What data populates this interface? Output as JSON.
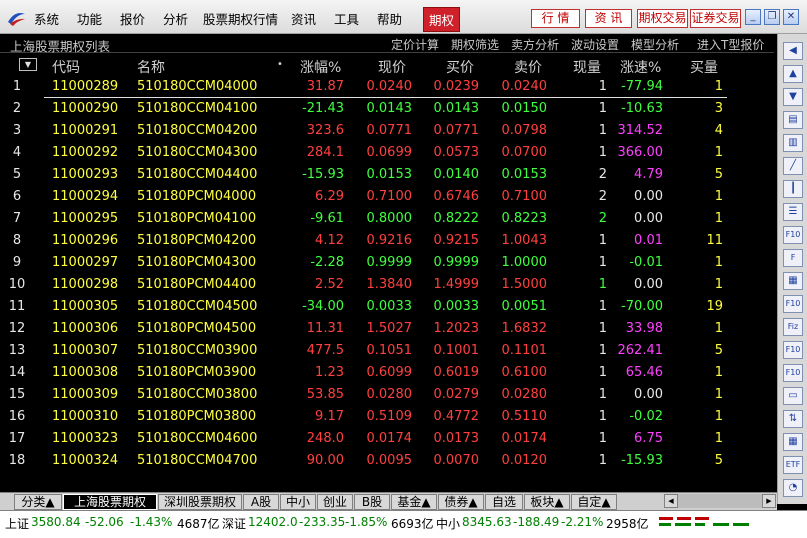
{
  "menu": {
    "items": [
      "系统",
      "功能",
      "报价",
      "分析",
      "股票期权行情",
      "资讯",
      "工具",
      "帮助"
    ],
    "active_item": "期权",
    "tools": [
      "行 情",
      "资 讯",
      "期权交易",
      "证券交易"
    ],
    "window_controls": [
      "minimize-icon",
      "restore-icon",
      "close-icon"
    ]
  },
  "titlebar": {
    "title": "上海股票期权列表",
    "links": [
      "定价计算",
      "期权筛选",
      "卖方分析",
      "波动设置",
      "模型分析",
      "进入T型报价"
    ]
  },
  "table": {
    "columns": [
      "代码",
      "名称",
      "•",
      "涨幅%",
      "现价",
      "买价",
      "卖价",
      "现量",
      "涨速%",
      "买量"
    ],
    "rows": [
      {
        "idx": "1",
        "code": "11000289",
        "name": "510180CCM04000",
        "chg": "31.87",
        "price": "0.0240",
        "bid": "0.0239",
        "ask": "0.0240",
        "vol": "1",
        "spd": "-77.94",
        "bq": "1"
      },
      {
        "idx": "2",
        "code": "11000290",
        "name": "510180CCM04100",
        "chg": "-21.43",
        "price": "0.0143",
        "bid": "0.0143",
        "ask": "0.0150",
        "vol": "1",
        "spd": "-10.63",
        "bq": "3"
      },
      {
        "idx": "3",
        "code": "11000291",
        "name": "510180CCM04200",
        "chg": "323.6",
        "price": "0.0771",
        "bid": "0.0771",
        "ask": "0.0798",
        "vol": "1",
        "spd": "314.52",
        "bq": "4"
      },
      {
        "idx": "4",
        "code": "11000292",
        "name": "510180CCM04300",
        "chg": "284.1",
        "price": "0.0699",
        "bid": "0.0573",
        "ask": "0.0700",
        "vol": "1",
        "spd": "366.00",
        "bq": "1"
      },
      {
        "idx": "5",
        "code": "11000293",
        "name": "510180CCM04400",
        "chg": "-15.93",
        "price": "0.0153",
        "bid": "0.0140",
        "ask": "0.0153",
        "vol": "2",
        "spd": "4.79",
        "bq": "5"
      },
      {
        "idx": "6",
        "code": "11000294",
        "name": "510180PCM04000",
        "chg": "6.29",
        "price": "0.7100",
        "bid": "0.6746",
        "ask": "0.7100",
        "vol": "2",
        "spd": "0.00",
        "bq": "1"
      },
      {
        "idx": "7",
        "code": "11000295",
        "name": "510180PCM04100",
        "chg": "-9.61",
        "price": "0.8000",
        "bid": "0.8222",
        "ask": "0.8223",
        "vol": "2",
        "spd": "0.00",
        "bq": "1"
      },
      {
        "idx": "8",
        "code": "11000296",
        "name": "510180PCM04200",
        "chg": "4.12",
        "price": "0.9216",
        "bid": "0.9215",
        "ask": "1.0043",
        "vol": "1",
        "spd": "0.01",
        "bq": "11"
      },
      {
        "idx": "9",
        "code": "11000297",
        "name": "510180PCM04300",
        "chg": "-2.28",
        "price": "0.9999",
        "bid": "0.9999",
        "ask": "1.0000",
        "vol": "1",
        "spd": "-0.01",
        "bq": "1"
      },
      {
        "idx": "10",
        "code": "11000298",
        "name": "510180PCM04400",
        "chg": "2.52",
        "price": "1.3840",
        "bid": "1.4999",
        "ask": "1.5000",
        "vol": "1",
        "spd": "0.00",
        "bq": "1"
      },
      {
        "idx": "11",
        "code": "11000305",
        "name": "510180CCM04500",
        "chg": "-34.00",
        "price": "0.0033",
        "bid": "0.0033",
        "ask": "0.0051",
        "vol": "1",
        "spd": "-70.00",
        "bq": "19"
      },
      {
        "idx": "12",
        "code": "11000306",
        "name": "510180PCM04500",
        "chg": "11.31",
        "price": "1.5027",
        "bid": "1.2023",
        "ask": "1.6832",
        "vol": "1",
        "spd": "33.98",
        "bq": "1"
      },
      {
        "idx": "13",
        "code": "11000307",
        "name": "510180CCM03900",
        "chg": "477.5",
        "price": "0.1051",
        "bid": "0.1001",
        "ask": "0.1101",
        "vol": "1",
        "spd": "262.41",
        "bq": "5"
      },
      {
        "idx": "14",
        "code": "11000308",
        "name": "510180PCM03900",
        "chg": "1.23",
        "price": "0.6099",
        "bid": "0.6019",
        "ask": "0.6100",
        "vol": "1",
        "spd": "65.46",
        "bq": "1"
      },
      {
        "idx": "15",
        "code": "11000309",
        "name": "510180CCM03800",
        "chg": "53.85",
        "price": "0.0280",
        "bid": "0.0279",
        "ask": "0.0280",
        "vol": "1",
        "spd": "0.00",
        "bq": "1"
      },
      {
        "idx": "16",
        "code": "11000310",
        "name": "510180PCM03800",
        "chg": "9.17",
        "price": "0.5109",
        "bid": "0.4772",
        "ask": "0.5110",
        "vol": "1",
        "spd": "-0.02",
        "bq": "1"
      },
      {
        "idx": "17",
        "code": "11000323",
        "name": "510180CCM04600",
        "chg": "248.0",
        "price": "0.0174",
        "bid": "0.0173",
        "ask": "0.0174",
        "vol": "1",
        "spd": "6.75",
        "bq": "1"
      },
      {
        "idx": "18",
        "code": "11000324",
        "name": "510180CCM04700",
        "chg": "90.00",
        "price": "0.0095",
        "bid": "0.0070",
        "ask": "0.0120",
        "vol": "1",
        "spd": "-15.93",
        "bq": "5"
      }
    ]
  },
  "right_toolbar": [
    "arrow-left-icon",
    "arrow-up-icon",
    "arrow-down-icon",
    "tick-chart-icon",
    "kline-chart-icon",
    "line-chart-icon",
    "candlestick-icon",
    "list-icon",
    "F10",
    "F",
    "news-icon",
    "F10",
    "Fiz",
    "F10",
    "F10",
    "folder-icon",
    "arrow-updown-icon",
    "grid-icon",
    "ETF",
    "clock-icon"
  ],
  "tabs": {
    "items": [
      "分类▲",
      "上海股票期权",
      "深圳股票期权",
      "A股",
      "中小",
      "创业",
      "B股",
      "基金▲",
      "债券▲",
      "自选",
      "板块▲",
      "自定▲"
    ],
    "active": "上海股票期权"
  },
  "status": {
    "sh_label": "上证",
    "sh_value": "3580.84",
    "sh_change": "-52.06",
    "sh_pct": "-1.43%",
    "sh_amount": "4687亿",
    "sz_label": "深证",
    "sz_value": "12402.0",
    "sz_change": "-233.35",
    "sz_pct": "-1.85%",
    "sz_amount": "6693亿",
    "zx_label": "中小",
    "zx_value": "8345.63",
    "zx_change": "-188.49",
    "zx_pct": "-2.21%",
    "zx_amount": "2958亿"
  },
  "colors": {
    "up": "#ff4040",
    "down": "#40ff40",
    "flat": "#e8e8e8",
    "highlight": "#ffff40",
    "speed_up": "#ff40ff"
  }
}
